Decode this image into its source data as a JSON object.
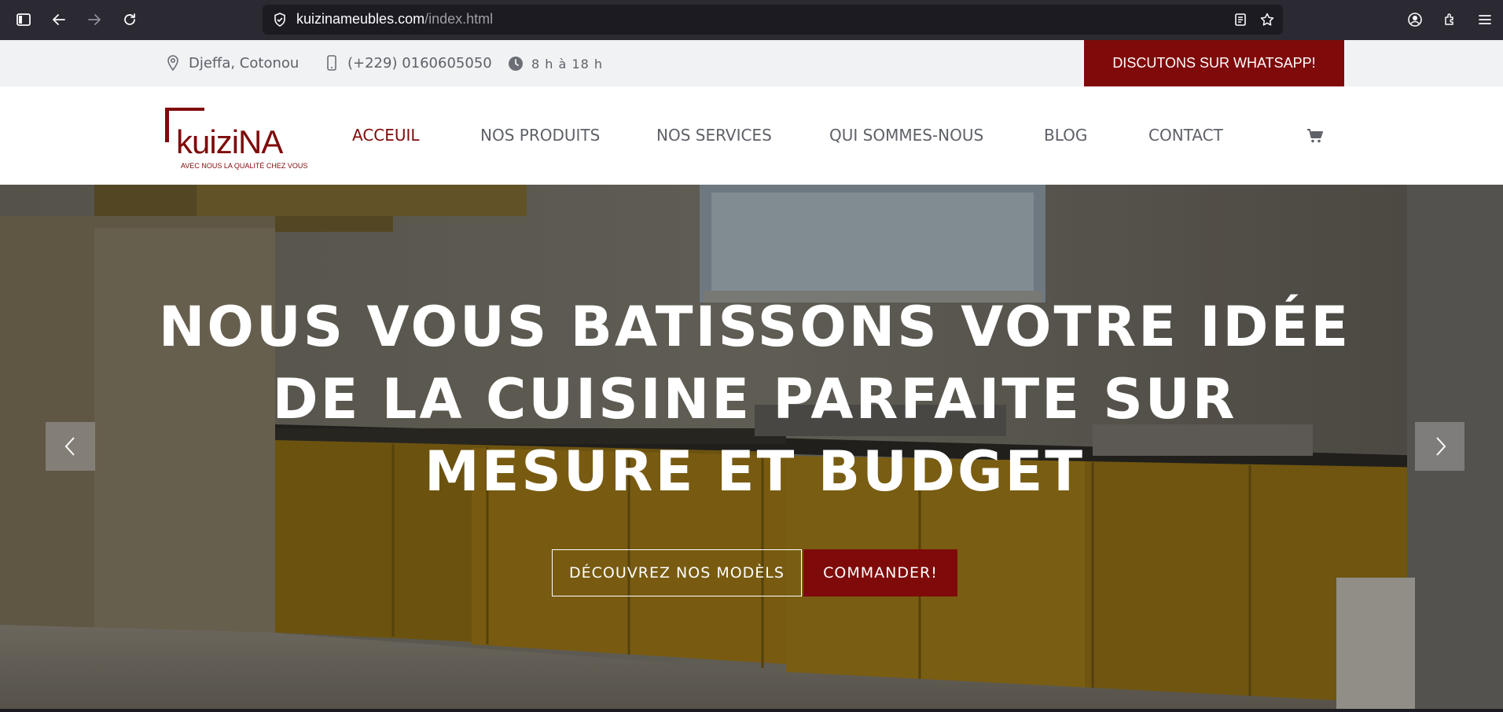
{
  "browser": {
    "url_domain": "kuizinameubles.com",
    "url_path": "/index.html"
  },
  "topbar": {
    "location": "Djeffa, Cotonou",
    "phone": "(+229) 0160605050",
    "hours": "8 h à 18 h",
    "whatsapp_label": "DISCUTONS SUR WHATSAPP!"
  },
  "logo": {
    "name": "KUIZINA",
    "tagline": "AVEC NOUS LA QUALITÉ CHEZ VOUS"
  },
  "nav": {
    "items": [
      {
        "label": "ACCEUIL",
        "active": true
      },
      {
        "label": "NOS PRODUITS",
        "active": false
      },
      {
        "label": "NOS SERVICES",
        "active": false
      },
      {
        "label": "QUI SOMMES-NOUS",
        "active": false
      },
      {
        "label": "BLOG",
        "active": false
      },
      {
        "label": "CONTACT",
        "active": false
      }
    ],
    "cart_icon": "cart-icon"
  },
  "hero": {
    "title_line1": "NOUS VOUS BATISSONS VOTRE IDÉE",
    "title_line2": "DE LA CUISINE PARFAITE SUR",
    "title_line3": "MESURE ET BUDGET",
    "btn_discover": "DÉCOUVREZ NOS MODÈLS",
    "btn_order": "COMMANDER!"
  },
  "colors": {
    "brand": "#7f0a0a",
    "topbar_bg": "#f1f2f4",
    "text_gray": "#5e6168"
  }
}
